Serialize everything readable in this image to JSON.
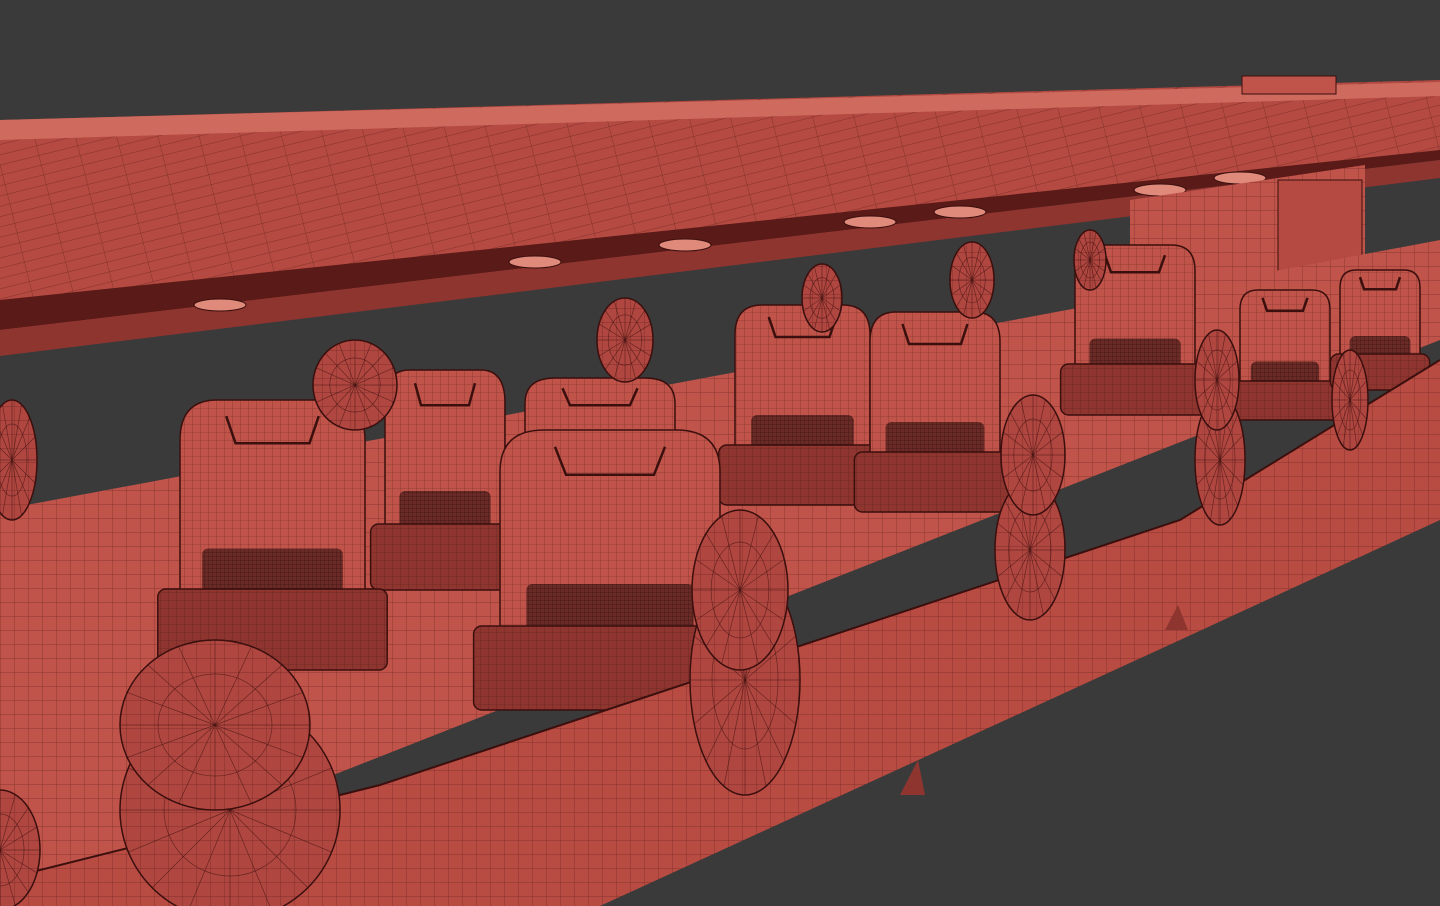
{
  "scene": {
    "background_color": "#3a3a3a",
    "mesh_color": "#c0544a",
    "mesh_shade_color": "#8e3530",
    "wire_color": "#3a0f0d",
    "cushion_color": "#6a2a26",
    "subject": "wireframe-render"
  }
}
